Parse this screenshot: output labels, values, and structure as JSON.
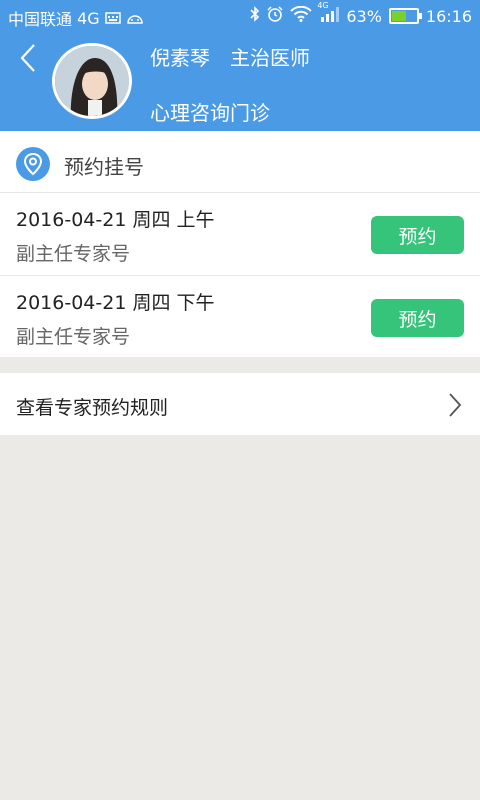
{
  "status_bar": {
    "carrier": "中国联通",
    "network": "4G",
    "battery_text": "63%",
    "battery_level": 0.63,
    "time": "16:16",
    "mobile_badge": "4G"
  },
  "header": {
    "doctor_name": "倪素琴",
    "doctor_title": "主治医师",
    "department": "心理咨询门诊"
  },
  "appointments": {
    "section_title": "预约挂号",
    "items": [
      {
        "date": "2016-04-21 周四 上午",
        "type": "副主任专家号",
        "button": "预约"
      },
      {
        "date": "2016-04-21 周四 下午",
        "type": "副主任专家号",
        "button": "预约"
      }
    ]
  },
  "rules_link": {
    "label": "查看专家预约规则"
  },
  "colors": {
    "header_bg": "#4a9ae6",
    "button_bg": "#36c37a",
    "page_bg": "#eceae6"
  }
}
